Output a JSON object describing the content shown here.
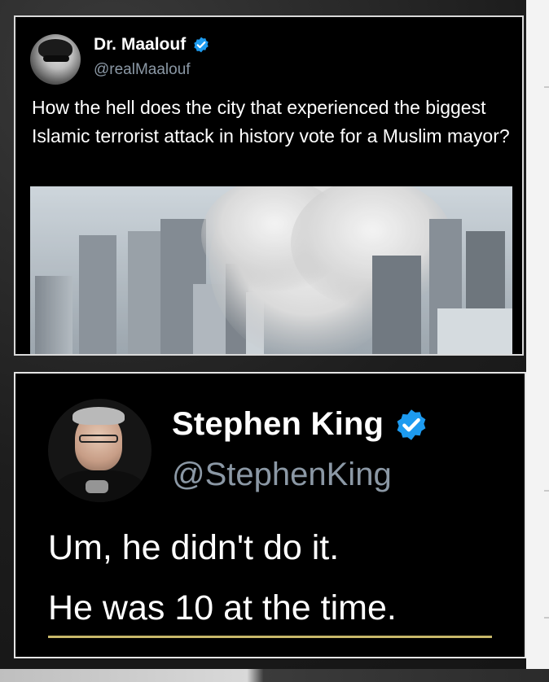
{
  "tweet1": {
    "author_name": "Dr. Maalouf",
    "handle": "@realMaalouf",
    "text": "How the hell does the city that experienced the biggest Islamic terrorist attack in history vote for a Muslim mayor?",
    "verified_color": "#1d9bf0"
  },
  "tweet2": {
    "author_name": "Stephen King",
    "handle": "@StephenKing",
    "line1": "Um, he didn't do it.",
    "line2": "He was 10 at the time.",
    "verified_color": "#1d9bf0",
    "highlight_color": "#c8b86a"
  }
}
